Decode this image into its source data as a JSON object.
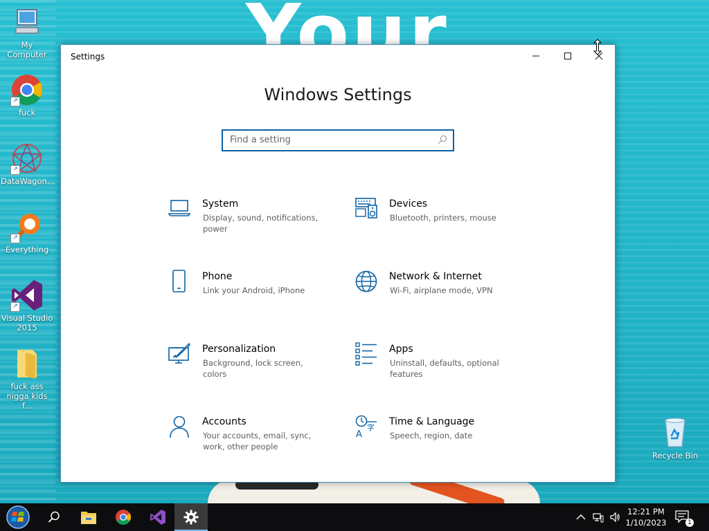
{
  "desktop": {
    "icons": [
      {
        "label": "My Computer",
        "icon": "computer-icon"
      },
      {
        "label": "fuck",
        "icon": "chrome-icon"
      },
      {
        "label": "DataWagon...",
        "icon": "datawagon-icon"
      },
      {
        "label": "Everything",
        "icon": "everything-search-icon"
      },
      {
        "label": "Visual Studio 2015",
        "icon": "visual-studio-icon"
      },
      {
        "label": "fuck ass nigga kids f...",
        "icon": "folder-icon"
      },
      {
        "label": "Recycle Bin",
        "icon": "recycle-bin-icon"
      }
    ]
  },
  "window": {
    "title": "Settings",
    "controls": {
      "minimize": "minimize-icon",
      "maximize": "maximize-icon",
      "close": "close-icon"
    },
    "heading": "Windows Settings",
    "search": {
      "placeholder": "Find a setting",
      "value": ""
    },
    "categories": [
      {
        "name": "System",
        "desc": "Display, sound, notifications, power",
        "icon": "laptop-icon"
      },
      {
        "name": "Devices",
        "desc": "Bluetooth, printers, mouse",
        "icon": "keyboard-speaker-icon"
      },
      {
        "name": "Phone",
        "desc": "Link your Android, iPhone",
        "icon": "phone-icon"
      },
      {
        "name": "Network & Internet",
        "desc": "Wi-Fi, airplane mode, VPN",
        "icon": "globe-icon"
      },
      {
        "name": "Personalization",
        "desc": "Background, lock screen, colors",
        "icon": "paint-brush-icon"
      },
      {
        "name": "Apps",
        "desc": "Uninstall, defaults, optional features",
        "icon": "apps-list-icon"
      },
      {
        "name": "Accounts",
        "desc": "Your accounts, email, sync, work, other people",
        "icon": "person-icon"
      },
      {
        "name": "Time & Language",
        "desc": "Speech, region, date",
        "icon": "time-language-icon"
      }
    ]
  },
  "taskbar": {
    "buttons": [
      "start-icon",
      "search-icon",
      "file-explorer-icon",
      "chrome-icon",
      "visual-studio-icon",
      "settings-gear-icon"
    ],
    "clock": {
      "time": "12:21 PM",
      "date": "1/10/2023"
    },
    "notification_count": "1"
  },
  "colors": {
    "accent": "#0a62a6",
    "taskbar": "#0d0d0f",
    "desktop": "#1fb6c8"
  }
}
